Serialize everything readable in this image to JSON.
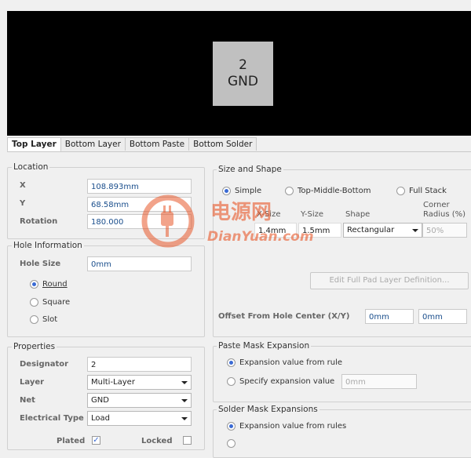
{
  "preview": {
    "pad_number": "2",
    "pad_net": "GND"
  },
  "tabs": [
    "Top Layer",
    "Bottom Layer",
    "Bottom Paste",
    "Bottom Solder"
  ],
  "location": {
    "title": "Location",
    "x_label": "X",
    "x_value": "108.893mm",
    "y_label": "Y",
    "y_value": "68.58mm",
    "rotation_label": "Rotation",
    "rotation_value": "180.000"
  },
  "hole": {
    "title": "Hole Information",
    "size_label": "Hole Size",
    "size_value": "0mm",
    "shapes": [
      "Round",
      "Square",
      "Slot"
    ],
    "selected": "Round"
  },
  "properties": {
    "title": "Properties",
    "designator_label": "Designator",
    "designator_value": "2",
    "layer_label": "Layer",
    "layer_value": "Multi-Layer",
    "net_label": "Net",
    "net_value": "GND",
    "etype_label": "Electrical Type",
    "etype_value": "Load",
    "plated_label": "Plated",
    "plated": true,
    "locked_label": "Locked",
    "locked": false
  },
  "size_shape": {
    "title": "Size and Shape",
    "modes": [
      "Simple",
      "Top-Middle-Bottom",
      "Full Stack"
    ],
    "selected": "Simple",
    "xsize_label": "X-Size",
    "ysize_label": "Y-Size",
    "shape_label": "Shape",
    "corner_label_1": "Corner",
    "corner_label_2": "Radius (%)",
    "xsize_value": "1.4mm",
    "ysize_value": "1.5mm",
    "shape_value": "Rectangular",
    "corner_value": "50%",
    "edit_button": "Edit Full Pad Layer Definition...",
    "offset_label": "Offset From Hole Center (X/Y)",
    "offset_x": "0mm",
    "offset_y": "0mm"
  },
  "paste_mask": {
    "title": "Paste Mask Expansion",
    "rule_option": "Expansion value from rule",
    "specify_option": "Specify expansion value",
    "specify_value": "0mm"
  },
  "solder_mask": {
    "title": "Solder Mask Expansions",
    "rule_option": "Expansion value from rules"
  },
  "watermark": {
    "cn": "电源网",
    "en": "DianYuan.com",
    "brand_color": "#e8582a"
  }
}
